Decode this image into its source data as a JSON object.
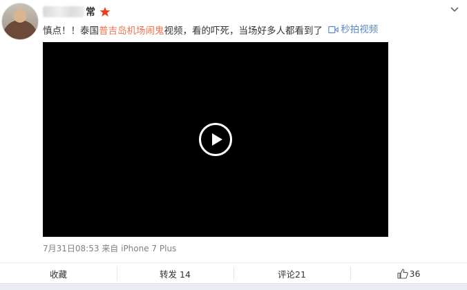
{
  "post": {
    "username": "常",
    "text_prefix": "慎点！！泰国",
    "text_highlight": "普吉岛机场闹鬼",
    "text_suffix": "视频，看的吓死，当场好多人都看到了",
    "video_link_label": "秒拍视频",
    "meta": "7月31日08:53 来自 iPhone 7 Plus"
  },
  "actions": {
    "favorite_label": "收藏",
    "repost_label": "转发 14",
    "comment_label": "评论21",
    "like_count": "36"
  },
  "colors": {
    "highlight": "#eb7350",
    "link": "#5b86c5",
    "vip_star": "#e8401e",
    "video_bg": "#000000"
  },
  "icons": {
    "vip": "star-icon",
    "menu": "chevron-down-icon",
    "video_link": "video-camera-icon",
    "play": "play-icon",
    "like": "thumbs-up-icon"
  }
}
